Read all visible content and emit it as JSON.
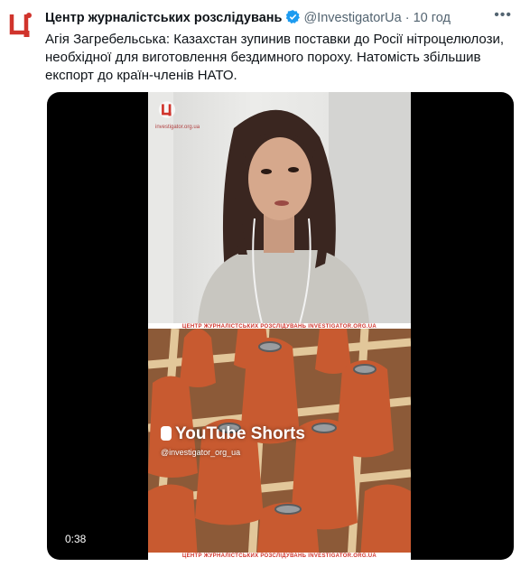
{
  "tweet": {
    "author": "Центр журналістських розслідувань",
    "handle": "@InvestigatorUa",
    "separator": "·",
    "time": "10 год",
    "text": "Агія Загребельська: Казахстан зупинив поставки до Росії нітроцелюлози, необхідної для виготовлення бездимного пороху. Натомість збільшив експорт до країн-членів НАТО."
  },
  "media": {
    "banner_text": "ЦЕНТР ЖУРНАЛІСТСЬКИХ РОЗСЛІДУВАНЬ INVESTIGATOR.ORG.UA",
    "watermark_site": "investigator.org.ua",
    "youtube_label": "YouTube Shorts",
    "youtube_handle": "@investigator_org_ua",
    "duration": "0:38"
  },
  "colors": {
    "brand_red": "#d0342c",
    "verified_blue": "#1d9bf0",
    "secondary_text": "#536471"
  }
}
